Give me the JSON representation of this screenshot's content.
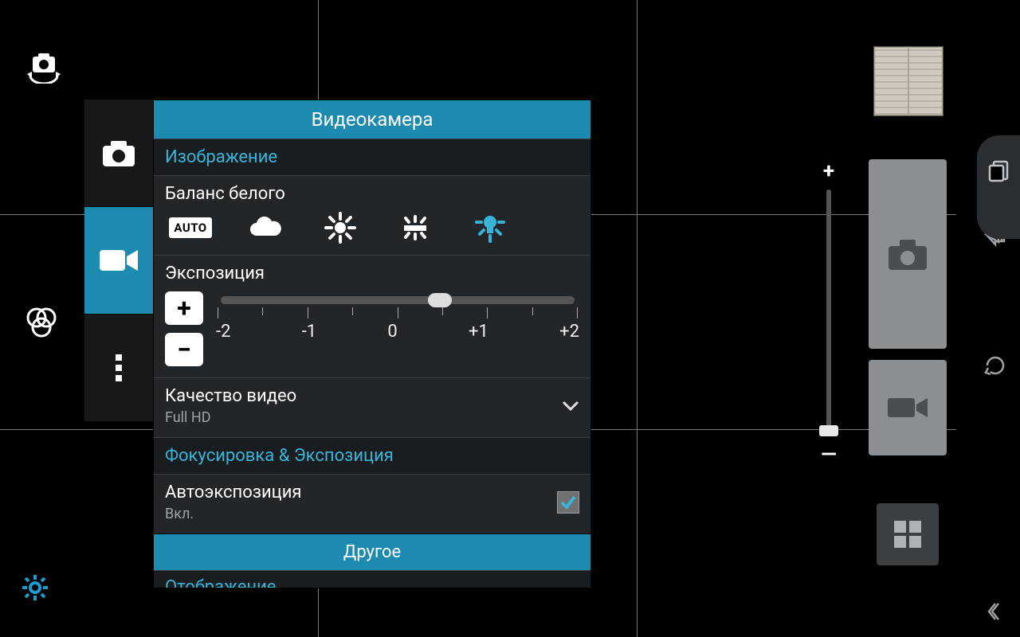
{
  "panel": {
    "title": "Видеокамера",
    "section_image": "Изображение",
    "wb_label": "Баланс белого",
    "wb_auto": "AUTO",
    "exposure_label": "Экспозиция",
    "exposure_ticks": {
      "m2": "-2",
      "m1": "-1",
      "z": "0",
      "p1": "+1",
      "p2": "+2"
    },
    "quality_label": "Качество видео",
    "quality_value": "Full HD",
    "section_focus": "Фокусировка & Экспозиция",
    "autoexp_label": "Автоэкспозиция",
    "autoexp_value": "Вкл.",
    "footer": "Другое",
    "cutoff": "Отображение"
  },
  "zoom": {
    "plus": "+",
    "minus": "—"
  }
}
